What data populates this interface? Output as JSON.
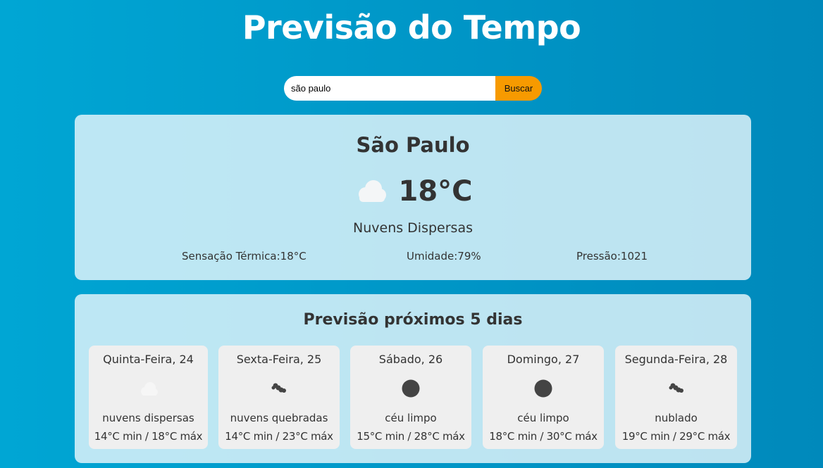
{
  "header": {
    "title": "Previsão do Tempo"
  },
  "search": {
    "value": "são paulo",
    "button_label": "Buscar"
  },
  "current": {
    "city": "São Paulo",
    "temperature": "18°C",
    "icon": "cloud-icon",
    "description": "Nuvens Dispersas",
    "feels_like": "Sensação Térmica:18°C",
    "humidity": "Umidade:79%",
    "pressure": "Pressão:1021"
  },
  "forecast": {
    "title": "Previsão próximos 5 dias",
    "days": [
      {
        "name": "Quinta-Feira, 24",
        "icon": "scattered-clouds-icon",
        "description": "nuvens dispersas",
        "range": "14°C min / 18°C máx"
      },
      {
        "name": "Sexta-Feira, 25",
        "icon": "broken-clouds-icon",
        "description": "nuvens quebradas",
        "range": "14°C min / 23°C máx"
      },
      {
        "name": "Sábado, 26",
        "icon": "clear-sky-icon",
        "description": "céu limpo",
        "range": "15°C min / 28°C máx"
      },
      {
        "name": "Domingo, 27",
        "icon": "clear-sky-icon",
        "description": "céu limpo",
        "range": "18°C min / 30°C máx"
      },
      {
        "name": "Segunda-Feira, 28",
        "icon": "overcast-clouds-icon",
        "description": "nublado",
        "range": "19°C min / 29°C máx"
      }
    ]
  }
}
